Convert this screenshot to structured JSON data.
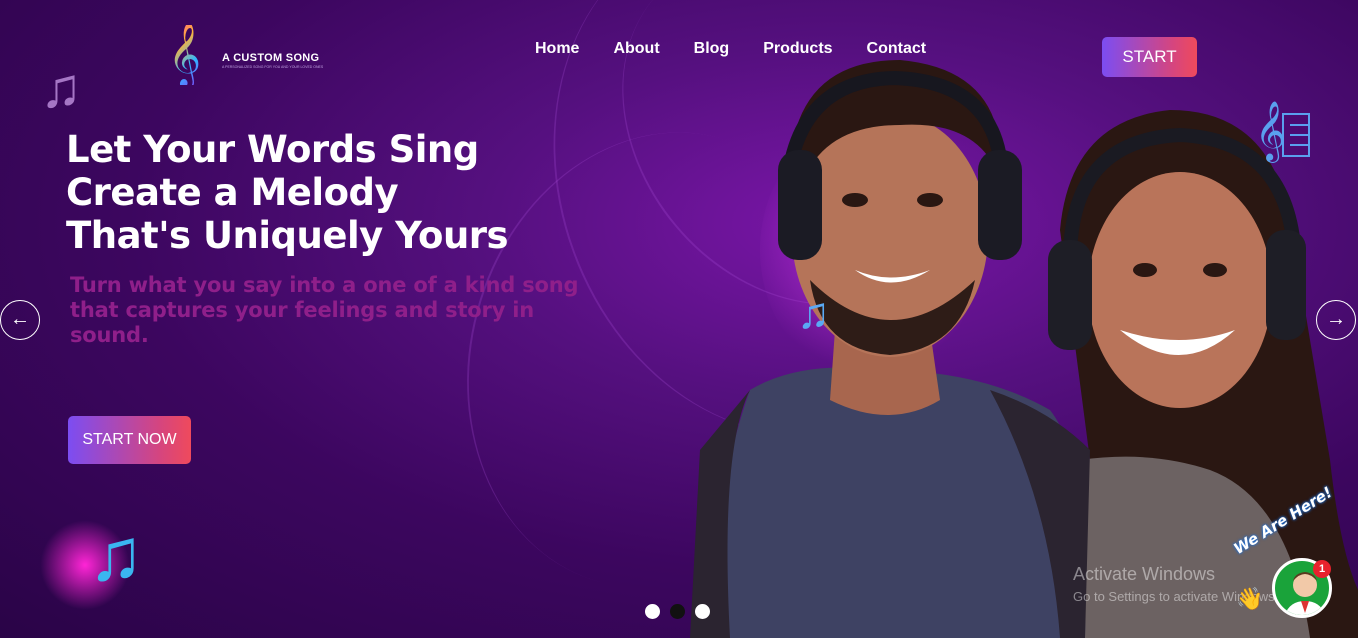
{
  "brand": {
    "name": "A CUSTOM SONG",
    "tagline": "A PERSONALIZED SONG FOR YOU AND YOUR LOVED ONES"
  },
  "nav": {
    "items": [
      "Home",
      "About",
      "Blog",
      "Products",
      "Contact"
    ],
    "cta_label": "START"
  },
  "hero": {
    "headline_lines": [
      "Let Your Words Sing",
      "Create a Melody",
      "That's Uniquely Yours"
    ],
    "subline": "Turn what you say into a one of a kind song that captures your feelings and story in sound.",
    "cta_label": "START NOW"
  },
  "carousel": {
    "prev_label": "←",
    "next_label": "→",
    "dot_count": 3,
    "active_dot": 2
  },
  "chat_widget": {
    "label": "We Are Here!",
    "badge_count": "1"
  },
  "system_watermark": {
    "title": "Activate Windows",
    "subtitle": "Go to Settings to activate Windows."
  },
  "colors": {
    "background": "#3c065f",
    "button_gradient_start": "#7c4df2",
    "button_gradient_end": "#ef4a5c",
    "subline": "#8f1f8a",
    "chat_green": "#1aa33a"
  },
  "icons": [
    "music-note-icon",
    "treble-clef-icon",
    "arrow-left-icon",
    "arrow-right-icon",
    "chat-avatar-icon"
  ]
}
